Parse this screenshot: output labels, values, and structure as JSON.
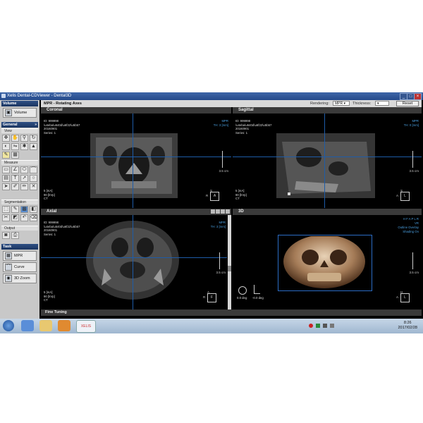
{
  "window": {
    "title": "Xelis Dental-CDViewer - Dental3D"
  },
  "left_panel": {
    "volume_header": "Volume",
    "volume_button": "Volume",
    "general_header": "General",
    "view_sub": "View",
    "measure_sub": "Measure",
    "segmentation_sub": "Segmentation",
    "output_sub": "Output",
    "task_header": "Task",
    "task_items": [
      "MPR",
      "Curve",
      "3D Zoom"
    ]
  },
  "mpr_header": {
    "title": "MPR - Rotating Axes",
    "rendering_label": "Rendering:",
    "rendering_value": "MPR",
    "thickness_label": "Thickness:",
    "reset": "Reset"
  },
  "views": {
    "coronal": {
      "title": "Coronal",
      "info": "ID: 999998\n\\u4eba\\u540d\\u6f22\\u5b57\n20160901\nSeries: 1",
      "mode": "MPR",
      "th": "TH: 3 [mm]",
      "scale": "3.5 cm",
      "params": "5 [mA]\n90 [kVp]\nCT",
      "top_lbl": "S",
      "left_lbl": "R",
      "right_lbl": "L",
      "center_lbl": "A",
      "bottom_lbl": "I"
    },
    "sagittal": {
      "title": "Sagittal",
      "info": "ID: 999998\n\\u4eba\\u540d\\u6f22\\u5b57\n20160901\nSeries: 1",
      "mode": "MPR",
      "th": "TH: 0 [mm]",
      "scale": "3.5 cm",
      "params": "5 [mA]\n90 [kVp]\nCT",
      "top_lbl": "S",
      "left_lbl": "A",
      "right_lbl": "P",
      "center_lbl": "L",
      "bottom_lbl": "I"
    },
    "axial": {
      "title": "Axial",
      "info": "ID: 999998\n\\u4eba\\u540d\\u6f22\\u5b57\n20160901\nSeries: 1",
      "mode": "MPR",
      "th": "TH: 3 [mm]",
      "scale": "3.5 cm",
      "params": "5 [mA]\n90 [kVp]\nCT",
      "top_lbl": "A",
      "left_lbl": "R",
      "right_lbl": "L",
      "center_lbl": "F",
      "bottom_lbl": "P"
    },
    "view3d": {
      "title": "3D",
      "legend": "H F A P L R",
      "vr": "VR",
      "outline": "Outline Overlay",
      "shading": "Shading On",
      "scale": "3.5 cm",
      "angle1": "0.0 deg",
      "angle2": "-0.0 deg",
      "top_lbl": "H",
      "left_lbl": "A",
      "right_lbl": "P",
      "center_lbl": "L",
      "bottom_lbl": "F"
    }
  },
  "fine_tuning": {
    "title": "Fine Tuning"
  },
  "taskbar": {
    "time": "8:26",
    "date": "2017/02/28",
    "app_label": "XELIS"
  },
  "colors": {
    "title_bar": "#24498a",
    "crosshair": "#1e5ca8",
    "overlay_blue": "#4a9fe0",
    "panel_bg": "#c8c8c8"
  }
}
